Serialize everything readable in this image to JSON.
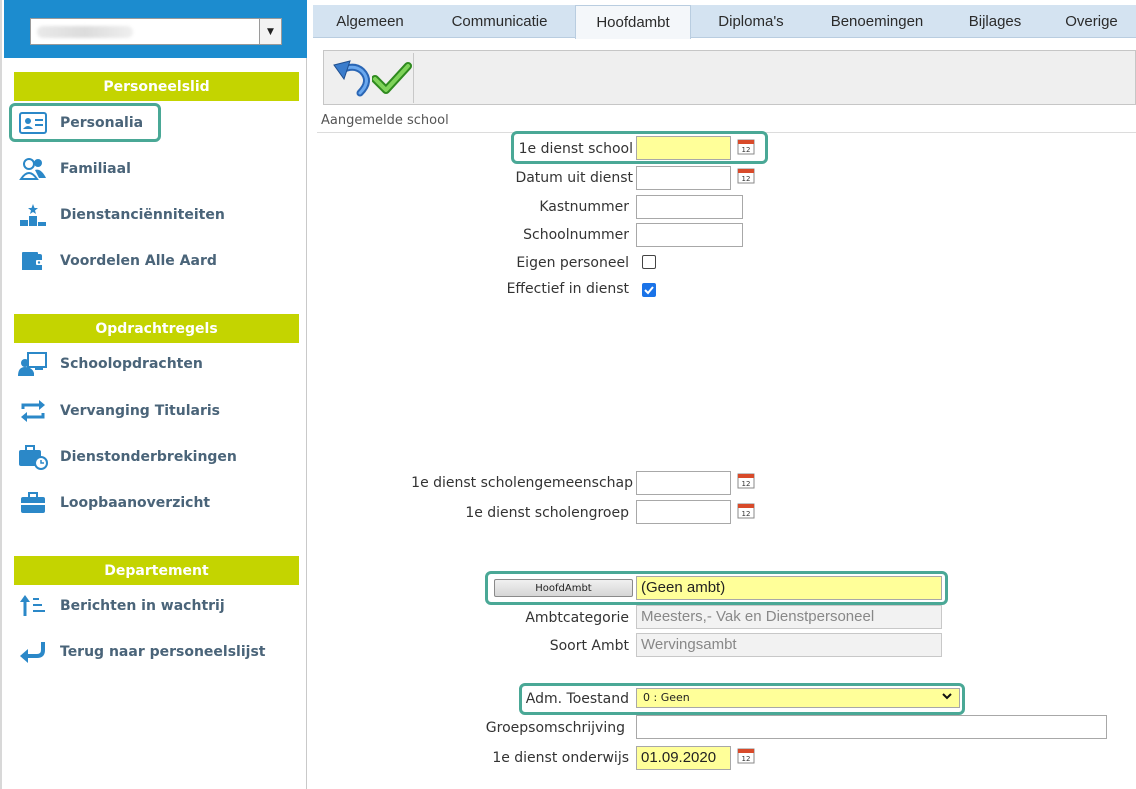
{
  "sidebar": {
    "sections": [
      {
        "title": "Personeelslid",
        "items": [
          {
            "label": "Personalia",
            "icon": "id-card-icon"
          },
          {
            "label": "Familiaal",
            "icon": "users-icon"
          },
          {
            "label": "Dienstanciënniteiten",
            "icon": "podium-icon"
          },
          {
            "label": "Voordelen Alle Aard",
            "icon": "wallet-icon"
          }
        ]
      },
      {
        "title": "Opdrachtregels",
        "items": [
          {
            "label": "Schoolopdrachten",
            "icon": "teacher-board-icon"
          },
          {
            "label": "Vervanging Titularis",
            "icon": "swap-arrows-icon"
          },
          {
            "label": "Dienstonderbrekingen",
            "icon": "briefcase-clock-icon"
          },
          {
            "label": "Loopbaanoverzicht",
            "icon": "briefcase-icon"
          }
        ]
      },
      {
        "title": "Departement",
        "items": [
          {
            "label": "Berichten in wachtrij",
            "icon": "sort-list-icon"
          },
          {
            "label": "Terug naar personeelslijst",
            "icon": "return-arrow-icon"
          }
        ]
      }
    ]
  },
  "tabs": [
    {
      "label": "Algemeen"
    },
    {
      "label": "Communicatie"
    },
    {
      "label": "Hoofdambt",
      "active": true
    },
    {
      "label": "Diploma's"
    },
    {
      "label": "Benoemingen"
    },
    {
      "label": "Bijlages"
    },
    {
      "label": "Overige"
    }
  ],
  "section_title": "Aangemelde school",
  "form": {
    "eerste_dienst_school": {
      "label": "1e dienst school",
      "value": ""
    },
    "datum_uit_dienst": {
      "label": "Datum uit dienst",
      "value": ""
    },
    "kastnummer": {
      "label": "Kastnummer",
      "value": ""
    },
    "schoolnummer": {
      "label": "Schoolnummer",
      "value": ""
    },
    "eigen_personeel": {
      "label": "Eigen personeel",
      "checked": false
    },
    "effectief_in_dienst": {
      "label": "Effectief in dienst",
      "checked": true
    },
    "eerste_dienst_scholengemeenschap": {
      "label": "1e dienst scholengemeenschap",
      "value": ""
    },
    "eerste_dienst_scholengroep": {
      "label": "1e dienst scholengroep",
      "value": ""
    },
    "hoofdambt_button": "HoofdAmbt",
    "hoofdambt_value": "(Geen ambt)",
    "ambtcategorie": {
      "label": "Ambtcategorie",
      "value": "Meesters,- Vak en Dienstpersoneel"
    },
    "soort_ambt": {
      "label": "Soort Ambt",
      "value": "Wervingsambt"
    },
    "adm_toestand": {
      "label": "Adm. Toestand",
      "value": "0 : Geen"
    },
    "groepsomschrijving": {
      "label": "Groepsomschrijving",
      "value": ""
    },
    "eerste_dienst_onderwijs": {
      "label": "1e dienst onderwijs",
      "value": "01.09.2020"
    }
  },
  "colors": {
    "accent": "#1c8ccf",
    "section": "#c4d400",
    "highlight": "#4aa896",
    "required": "#ffff99"
  }
}
